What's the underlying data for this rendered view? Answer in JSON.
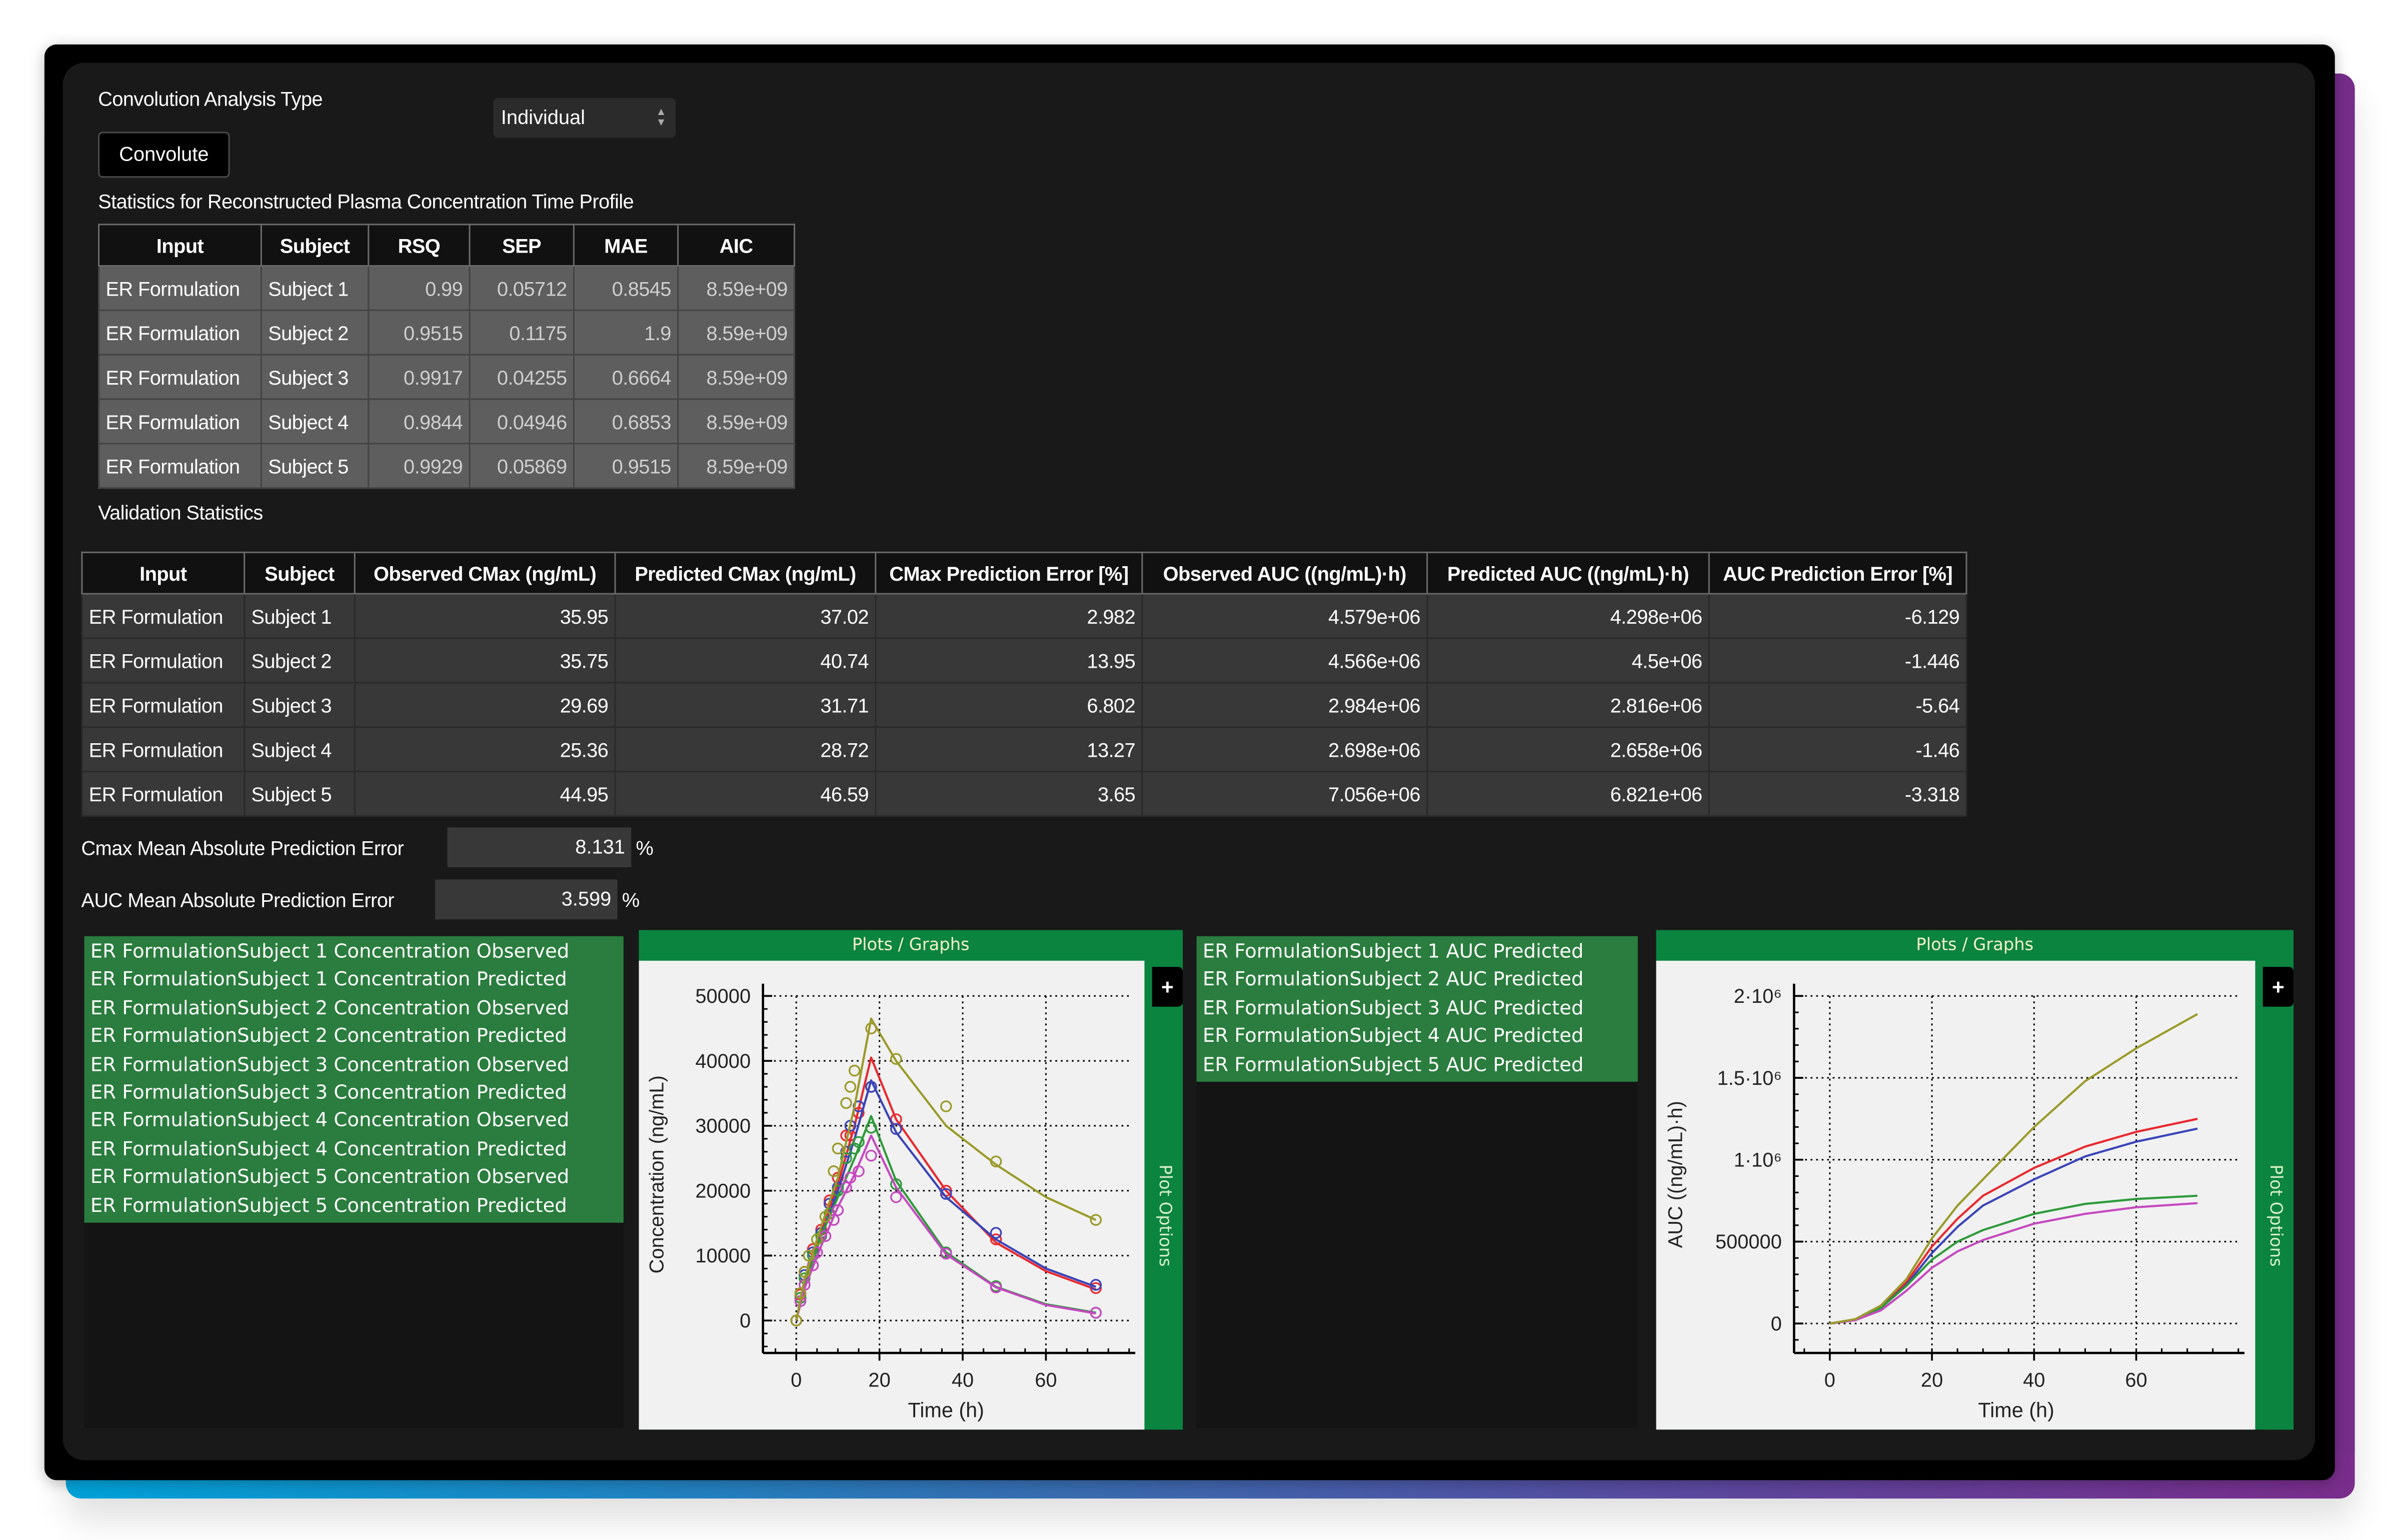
{
  "controls": {
    "analysis_type_label": "Convolution Analysis Type",
    "analysis_type_value": "Individual",
    "convolute_label": "Convolute"
  },
  "stats_section": {
    "title": "Statistics for Reconstructed Plasma Concentration Time Profile",
    "columns": [
      "Input",
      "Subject",
      "RSQ",
      "SEP",
      "MAE",
      "AIC"
    ],
    "rows": [
      [
        "ER Formulation",
        "Subject 1",
        "0.99",
        "0.05712",
        "0.8545",
        "8.59e+09"
      ],
      [
        "ER Formulation",
        "Subject 2",
        "0.9515",
        "0.1175",
        "1.9",
        "8.59e+09"
      ],
      [
        "ER Formulation",
        "Subject 3",
        "0.9917",
        "0.04255",
        "0.6664",
        "8.59e+09"
      ],
      [
        "ER Formulation",
        "Subject 4",
        "0.9844",
        "0.04946",
        "0.6853",
        "8.59e+09"
      ],
      [
        "ER Formulation",
        "Subject 5",
        "0.9929",
        "0.05869",
        "0.9515",
        "8.59e+09"
      ]
    ]
  },
  "validation_section": {
    "title": "Validation Statistics",
    "columns": [
      "Input",
      "Subject",
      "Observed CMax (ng/mL)",
      "Predicted CMax (ng/mL)",
      "CMax Prediction Error [%]",
      "Observed AUC ((ng/mL)·h)",
      "Predicted AUC ((ng/mL)·h)",
      "AUC Prediction Error [%]"
    ],
    "rows": [
      [
        "ER Formulation",
        "Subject 1",
        "35.95",
        "37.02",
        "2.982",
        "4.579e+06",
        "4.298e+06",
        "-6.129"
      ],
      [
        "ER Formulation",
        "Subject 2",
        "35.75",
        "40.74",
        "13.95",
        "4.566e+06",
        "4.5e+06",
        "-1.446"
      ],
      [
        "ER Formulation",
        "Subject 3",
        "29.69",
        "31.71",
        "6.802",
        "2.984e+06",
        "2.816e+06",
        "-5.64"
      ],
      [
        "ER Formulation",
        "Subject 4",
        "25.36",
        "28.72",
        "13.27",
        "2.698e+06",
        "2.658e+06",
        "-1.46"
      ],
      [
        "ER Formulation",
        "Subject 5",
        "44.95",
        "46.59",
        "3.65",
        "7.056e+06",
        "6.821e+06",
        "-3.318"
      ]
    ],
    "cmax_mape_label": "Cmax Mean Absolute Prediction Error",
    "cmax_mape_value": "8.131",
    "auc_mape_label": "AUC Mean Absolute Prediction Error",
    "auc_mape_value": "3.599",
    "unit_percent": "%"
  },
  "concentration_series_list": [
    "ER FormulationSubject 1 Concentration Observed",
    "ER FormulationSubject 1 Concentration Predicted",
    "ER FormulationSubject 2 Concentration Observed",
    "ER FormulationSubject 2 Concentration Predicted",
    "ER FormulationSubject 3 Concentration Observed",
    "ER FormulationSubject 3 Concentration Predicted",
    "ER FormulationSubject 4 Concentration Observed",
    "ER FormulationSubject 4 Concentration Predicted",
    "ER FormulationSubject 5 Concentration Observed",
    "ER FormulationSubject 5 Concentration Predicted"
  ],
  "auc_series_list": [
    "ER FormulationSubject 1 AUC Predicted",
    "ER FormulationSubject 2 AUC Predicted",
    "ER FormulationSubject 3 AUC Predicted",
    "ER FormulationSubject 4 AUC Predicted",
    "ER FormulationSubject 5 AUC Predicted"
  ],
  "plot_panel": {
    "header": "Plots / Graphs",
    "plus_label": "+",
    "options_label": "Plot Options"
  },
  "colors": {
    "accent_green": "#0b8440",
    "list_green": "#2a7d3e",
    "subject_1": "#e8292f",
    "subject_2": "#3a44b8",
    "subject_3": "#2e9a3a",
    "subject_4": "#c548c0",
    "subject_5": "#9a9a2a"
  },
  "chart_data": [
    {
      "type": "line",
      "title": "",
      "xlabel": "Time (h)",
      "ylabel": "Concentration (ng/mL)",
      "xlim": [
        -8,
        80
      ],
      "ylim": [
        -5000,
        50000
      ],
      "xticks": [
        0,
        20,
        40,
        60
      ],
      "yticks": [
        0,
        10000,
        20000,
        30000,
        40000,
        50000
      ],
      "grid": true,
      "series": [
        {
          "name": "Subject 1",
          "color": "#e8292f",
          "predicted": {
            "x": [
              0,
              2,
              6,
              10,
              14,
              18,
              24,
              36,
              48,
              60,
              72
            ],
            "y": [
              0,
              6000,
              14000,
              21000,
              30000,
              40500,
              31000,
              20000,
              12000,
              7600,
              4800
            ]
          },
          "observed": {
            "x": [
              0,
              1,
              2,
              4,
              6,
              8,
              10,
              12,
              13,
              15,
              18,
              24,
              36,
              48,
              72
            ],
            "y": [
              0,
              4000,
              7500,
              11000,
              14000,
              18500,
              22000,
              28500,
              28500,
              32000,
              36000,
              31000,
              20000,
              12500,
              5000
            ]
          }
        },
        {
          "name": "Subject 2",
          "color": "#3a44b8",
          "predicted": {
            "x": [
              0,
              2,
              6,
              10,
              14,
              18,
              24,
              36,
              48,
              60,
              72
            ],
            "y": [
              0,
              5500,
              13000,
              20000,
              28000,
              37000,
              29000,
              19000,
              12500,
              8000,
              5200
            ]
          },
          "observed": {
            "x": [
              0,
              1,
              2,
              4,
              6,
              8,
              10,
              12,
              13,
              15,
              18,
              24,
              36,
              48,
              72
            ],
            "y": [
              0,
              3500,
              7000,
              10500,
              13500,
              18000,
              20500,
              26000,
              30000,
              33000,
              36000,
              29500,
              19500,
              13500,
              5500
            ]
          }
        },
        {
          "name": "Subject 3",
          "color": "#2e9a3a",
          "predicted": {
            "x": [
              0,
              2,
              6,
              10,
              14,
              18,
              24,
              36,
              48,
              60,
              72
            ],
            "y": [
              0,
              5500,
              13000,
              19000,
              25000,
              31500,
              21500,
              10500,
              5200,
              2500,
              1200
            ]
          },
          "observed": {
            "x": [
              0,
              1,
              2,
              4,
              6,
              8,
              10,
              12,
              14,
              15,
              18,
              24,
              36,
              48,
              72
            ],
            "y": [
              0,
              3500,
              6500,
              10000,
              13000,
              16500,
              20000,
              25000,
              26500,
              27500,
              29700,
              21000,
              10500,
              5300,
              1200
            ]
          }
        },
        {
          "name": "Subject 4",
          "color": "#c548c0",
          "predicted": {
            "x": [
              0,
              2,
              6,
              10,
              14,
              18,
              24,
              36,
              48,
              60,
              72
            ],
            "y": [
              0,
              5000,
              11500,
              17500,
              22500,
              28500,
              20500,
              10200,
              5100,
              2400,
              1100
            ]
          },
          "observed": {
            "x": [
              0,
              1,
              2,
              4,
              5,
              7,
              9,
              10,
              12,
              13,
              15,
              18,
              24,
              36,
              48,
              72
            ],
            "y": [
              0,
              3000,
              5500,
              8500,
              10500,
              13000,
              15500,
              17000,
              20500,
              22000,
              23000,
              25400,
              19000,
              10300,
              5100,
              1200
            ]
          }
        },
        {
          "name": "Subject 5",
          "color": "#9a9a2a",
          "predicted": {
            "x": [
              0,
              2,
              6,
              10,
              14,
              18,
              24,
              36,
              48,
              60,
              72
            ],
            "y": [
              0,
              6500,
              14500,
              22000,
              33000,
              46500,
              40000,
              30000,
              24000,
              19000,
              15500
            ]
          },
          "observed": {
            "x": [
              0,
              1,
              2,
              3,
              5,
              7,
              9,
              10,
              12,
              13,
              14,
              18,
              24,
              36,
              48,
              72
            ],
            "y": [
              0,
              4200,
              7500,
              10000,
              12500,
              16000,
              23000,
              26500,
              33500,
              36000,
              38500,
              45000,
              40300,
              33000,
              24500,
              15500
            ]
          }
        }
      ]
    },
    {
      "type": "line",
      "title": "",
      "xlabel": "Time (h)",
      "ylabel": "AUC ((ng/mL)·h)",
      "xlim": [
        -7,
        80
      ],
      "ylim": [
        -180000,
        2000000
      ],
      "xticks": [
        0,
        20,
        40,
        60
      ],
      "yticks": [
        0,
        500000,
        1000000,
        1500000,
        2000000
      ],
      "ytick_labels": [
        "0",
        "500000",
        "1·10⁶",
        "1.5·10⁶",
        "2·10⁶"
      ],
      "grid": true,
      "series": [
        {
          "name": "Subject 1",
          "color": "#e8292f",
          "x": [
            0,
            5,
            10,
            15,
            20,
            25,
            30,
            40,
            50,
            60,
            72
          ],
          "y": [
            0,
            25000,
            100000,
            250000,
            470000,
            640000,
            780000,
            950000,
            1080000,
            1170000,
            1250000
          ]
        },
        {
          "name": "Subject 2",
          "color": "#3a44b8",
          "x": [
            0,
            5,
            10,
            15,
            20,
            25,
            30,
            40,
            50,
            60,
            72
          ],
          "y": [
            0,
            24000,
            95000,
            235000,
            430000,
            590000,
            720000,
            880000,
            1020000,
            1110000,
            1190000
          ]
        },
        {
          "name": "Subject 3",
          "color": "#2e9a3a",
          "x": [
            0,
            5,
            10,
            15,
            20,
            25,
            30,
            40,
            50,
            60,
            72
          ],
          "y": [
            0,
            24000,
            95000,
            230000,
            390000,
            500000,
            570000,
            670000,
            730000,
            760000,
            780000
          ]
        },
        {
          "name": "Subject 4",
          "color": "#c548c0",
          "x": [
            0,
            5,
            10,
            15,
            20,
            25,
            30,
            40,
            50,
            60,
            72
          ],
          "y": [
            0,
            20000,
            80000,
            200000,
            340000,
            440000,
            510000,
            610000,
            670000,
            710000,
            735000
          ]
        },
        {
          "name": "Subject 5",
          "color": "#9a9a2a",
          "x": [
            0,
            5,
            10,
            15,
            20,
            25,
            30,
            40,
            50,
            60,
            72
          ],
          "y": [
            0,
            27000,
            110000,
            270000,
            520000,
            720000,
            880000,
            1200000,
            1480000,
            1680000,
            1890000
          ]
        }
      ]
    }
  ]
}
